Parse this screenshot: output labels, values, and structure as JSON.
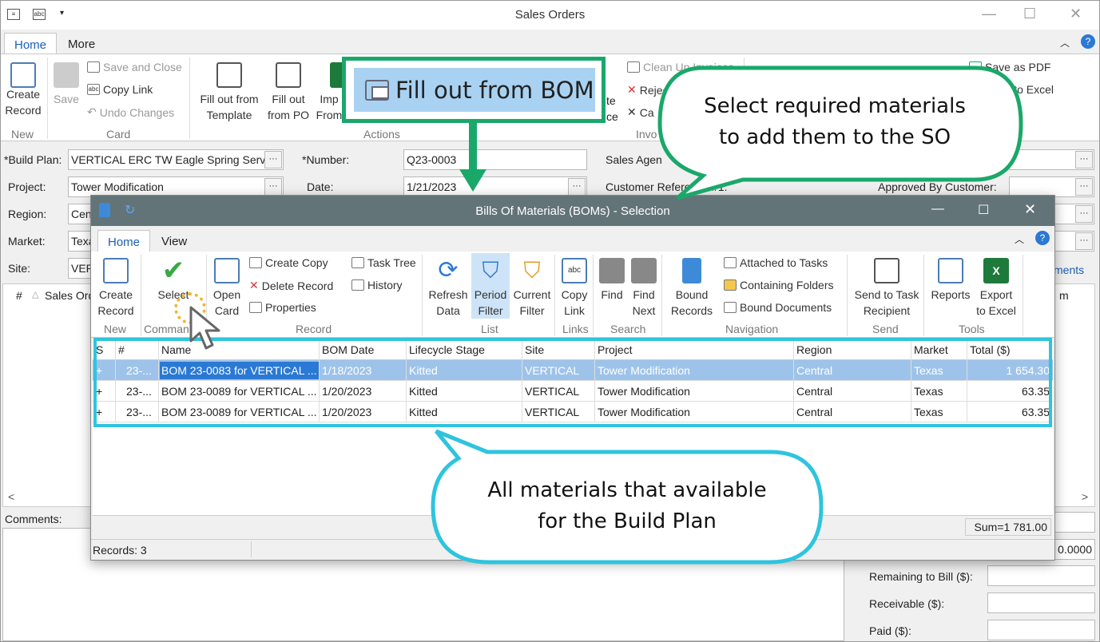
{
  "window": {
    "title": "Sales Orders"
  },
  "tabs": [
    "Home",
    "More"
  ],
  "ribbon": {
    "create_record": "Create\nRecord",
    "save": "Save",
    "save_and_close": "Save and Close",
    "copy_link": "Copy Link",
    "undo_changes": "Undo Changes",
    "fill_template_1": "Fill out from",
    "fill_template_2": "Template",
    "fill_po_1": "Fill out",
    "fill_po_2": "from PO",
    "import_1": "Imp",
    "import_2": "From",
    "fill_bom": "Fill out from BOM",
    "clean_up": "Clean Up Invoices",
    "reject": "Rejec",
    "cancel": "Ca",
    "invoice_1": "te",
    "invoice_2": "ce",
    "save_pdf": "Save as PDF",
    "export_excel": "ort to Excel",
    "misc": "h",
    "groups": {
      "new": "New",
      "card": "Card",
      "actions": "Actions",
      "invoices": "Invo"
    }
  },
  "form": {
    "build_plan_label": "*Build Plan:",
    "build_plan": "VERTICAL ERC TW Eagle Spring Servi",
    "project_label": "Project:",
    "project": "Tower Modification",
    "region_label": "Region:",
    "region": "Cen",
    "market_label": "Market:",
    "market": "Texa",
    "site_label": "Site:",
    "site": "VER",
    "number_label": "*Number:",
    "number": "Q23-0003",
    "date_label": "Date:",
    "date": "1/21/2023",
    "sales_agent_label": "Sales Agen",
    "customer_ref_label": "Customer Reference #1:",
    "approved_label": "Approved By Customer:",
    "comments_label": "Comments:",
    "remaining_label": "Remaining to Bill ($):",
    "receivable_label": "Receivable ($):",
    "paid_label": "Paid ($):",
    "amount": "0.0000",
    "ments": "ments",
    "m": "m",
    "hash": "#",
    "sales_ord": "Sales Ord"
  },
  "dialog": {
    "title": "Bills Of Materials (BOMs) - Selection",
    "tabs": [
      "Home",
      "View"
    ],
    "buttons": {
      "create_record_1": "Create",
      "create_record_2": "Record",
      "select": "Select",
      "open_card_1": "Open",
      "open_card_2": "Card",
      "create_copy": "Create Copy",
      "delete_record": "Delete Record",
      "properties": "Properties",
      "task_tree": "Task Tree",
      "history": "History",
      "refresh_1": "Refresh",
      "refresh_2": "Data",
      "period_1": "Period",
      "period_2": "Filter",
      "current_1": "Current",
      "current_2": "Filter",
      "copy_1": "Copy",
      "copy_2": "Link",
      "find": "Find",
      "find_next_1": "Find",
      "find_next_2": "Next",
      "bound_1": "Bound",
      "bound_2": "Records",
      "attached": "Attached to Tasks",
      "folders": "Containing Folders",
      "bound_docs": "Bound Documents",
      "send_1": "Send to Task",
      "send_2": "Recipient",
      "reports": "Reports",
      "export_1": "Export",
      "export_2": "to Excel"
    },
    "groups": {
      "new": "New",
      "commands": "Commands",
      "record": "Record",
      "list": "List",
      "links": "Links",
      "search": "Search",
      "navigation": "Navigation",
      "send": "Send",
      "tools": "Tools"
    },
    "columns": [
      "S",
      "#",
      "Name",
      "BOM Date",
      "Lifecycle Stage",
      "Site",
      "Project",
      "Region",
      "Market",
      "Total ($)"
    ],
    "rows": [
      {
        "s": "+",
        "num": "23-...",
        "name": "BOM 23-0083 for VERTICAL ...",
        "date": "1/18/2023",
        "stage": "Kitted",
        "site": "VERTICAL",
        "project": "Tower Modification",
        "region": "Central",
        "market": "Texas",
        "total": "1 654.30"
      },
      {
        "s": "+",
        "num": "23-...",
        "name": "BOM 23-0089 for VERTICAL ...",
        "date": "1/20/2023",
        "stage": "Kitted",
        "site": "VERTICAL",
        "project": "Tower Modification",
        "region": "Central",
        "market": "Texas",
        "total": "63.35"
      },
      {
        "s": "+",
        "num": "23-...",
        "name": "BOM 23-0089 for VERTICAL ...",
        "date": "1/20/2023",
        "stage": "Kitted",
        "site": "VERTICAL",
        "project": "Tower Modification",
        "region": "Central",
        "market": "Texas",
        "total": "63.35"
      }
    ],
    "sum": "Sum=1 781.00",
    "records": "Records: 3"
  },
  "callouts": {
    "top": "Select required materials\nto add them to the SO",
    "bottom": "All materials that available\nfor the Build Plan"
  },
  "colors": {
    "accent_green": "#1aa86a",
    "accent_cyan": "#2ec4de",
    "dialog_title": "#637479",
    "selection": "#2a79d5"
  }
}
